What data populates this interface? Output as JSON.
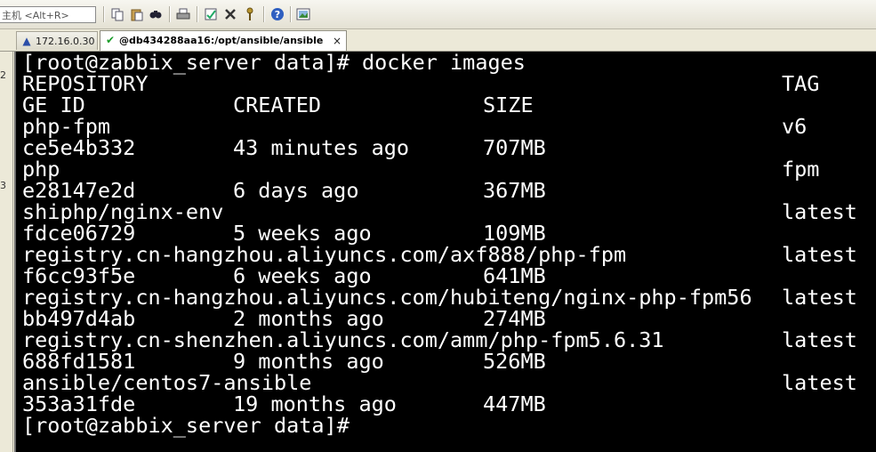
{
  "toolbar": {
    "host_placeholder": "主机 <Alt+R>",
    "buttons": [
      "copy-icon",
      "paste-icon",
      "find-icon",
      "print-icon",
      "properties-icon",
      "settings-icon",
      "key-icon",
      "help-icon",
      "screenshot-icon"
    ]
  },
  "tabs": [
    {
      "label": "172.16.0.30",
      "icon": "warning-icon",
      "active": false
    },
    {
      "label": "@db434288aa16:/opt/ansible/ansible",
      "icon": "check-icon",
      "active": true,
      "close": "×"
    }
  ],
  "sidebar": {
    "glyphs": [
      "2",
      "3"
    ]
  },
  "terminal": {
    "prompt_top": "[root@zabbix_server data]# docker images",
    "header1": {
      "repository": "REPOSITORY",
      "tag": "TAG"
    },
    "header2": {
      "image_id": "GE ID",
      "created": "CREATED",
      "size": "SIZE"
    },
    "images": [
      {
        "repository": "php-fpm",
        "tag": "v6",
        "image_id": "ce5e4b332",
        "created": "43 minutes ago",
        "size": "707MB"
      },
      {
        "repository": "php",
        "tag": "fpm",
        "image_id": "e28147e2d",
        "created": "6 days ago",
        "size": "367MB"
      },
      {
        "repository": "shiphp/nginx-env",
        "tag": "latest",
        "image_id": "fdce06729",
        "created": "5 weeks ago",
        "size": "109MB"
      },
      {
        "repository": "registry.cn-hangzhou.aliyuncs.com/axf888/php-fpm",
        "tag": "latest",
        "image_id": "f6cc93f5e",
        "created": "6 weeks ago",
        "size": "641MB"
      },
      {
        "repository": "registry.cn-hangzhou.aliyuncs.com/hubiteng/nginx-php-fpm56",
        "tag": "latest",
        "image_id": "bb497d4ab",
        "created": "2 months ago",
        "size": "274MB"
      },
      {
        "repository": "registry.cn-shenzhen.aliyuncs.com/amm/php-fpm5.6.31",
        "tag": "latest",
        "image_id": "688fd1581",
        "created": "9 months ago",
        "size": "526MB"
      },
      {
        "repository": "ansible/centos7-ansible",
        "tag": "latest",
        "image_id": "353a31fde",
        "created": "19 months ago",
        "size": "447MB"
      }
    ],
    "prompt_bottom": "[root@zabbix_server data]#"
  }
}
